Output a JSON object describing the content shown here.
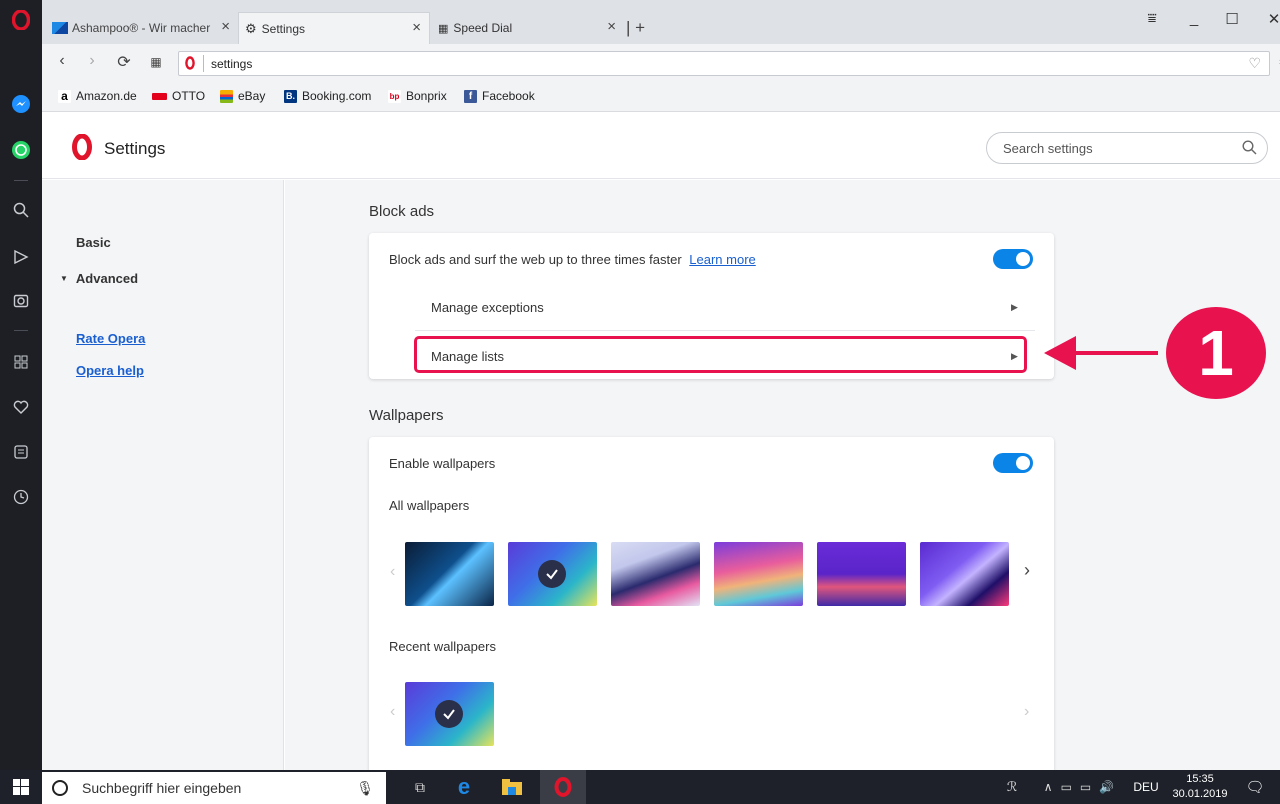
{
  "tabs": [
    {
      "label": "Ashampoo® - Wir macher",
      "active": false
    },
    {
      "label": "Settings",
      "active": true
    },
    {
      "label": "Speed Dial",
      "active": false
    }
  ],
  "address": {
    "url": "settings"
  },
  "bookmarks": [
    "Amazon.de",
    "OTTO",
    "eBay",
    "Booking.com",
    "Bonprix",
    "Facebook"
  ],
  "header": {
    "title": "Settings",
    "search_placeholder": "Search settings"
  },
  "leftnav": {
    "basic": "Basic",
    "advanced": "Advanced",
    "links": [
      "Rate Opera",
      "Opera help"
    ]
  },
  "blockads": {
    "title": "Block ads",
    "description": "Block ads and surf the web up to three times faster",
    "learn_more": "Learn more",
    "enabled": true,
    "rows": [
      "Manage exceptions",
      "Manage lists"
    ]
  },
  "wallpapers": {
    "title": "Wallpapers",
    "enable_label": "Enable wallpapers",
    "enabled": true,
    "all_label": "All wallpapers",
    "recent_label": "Recent wallpapers"
  },
  "annotation": {
    "number": "1",
    "color": "#e8124f"
  },
  "taskbar": {
    "search_placeholder": "Suchbegriff hier eingeben",
    "language": "DEU",
    "time": "15:35",
    "date": "30.01.2019"
  },
  "colors": {
    "accent": "#0a84e6",
    "opera_red": "#e0142b",
    "highlight": "#e8124f"
  }
}
